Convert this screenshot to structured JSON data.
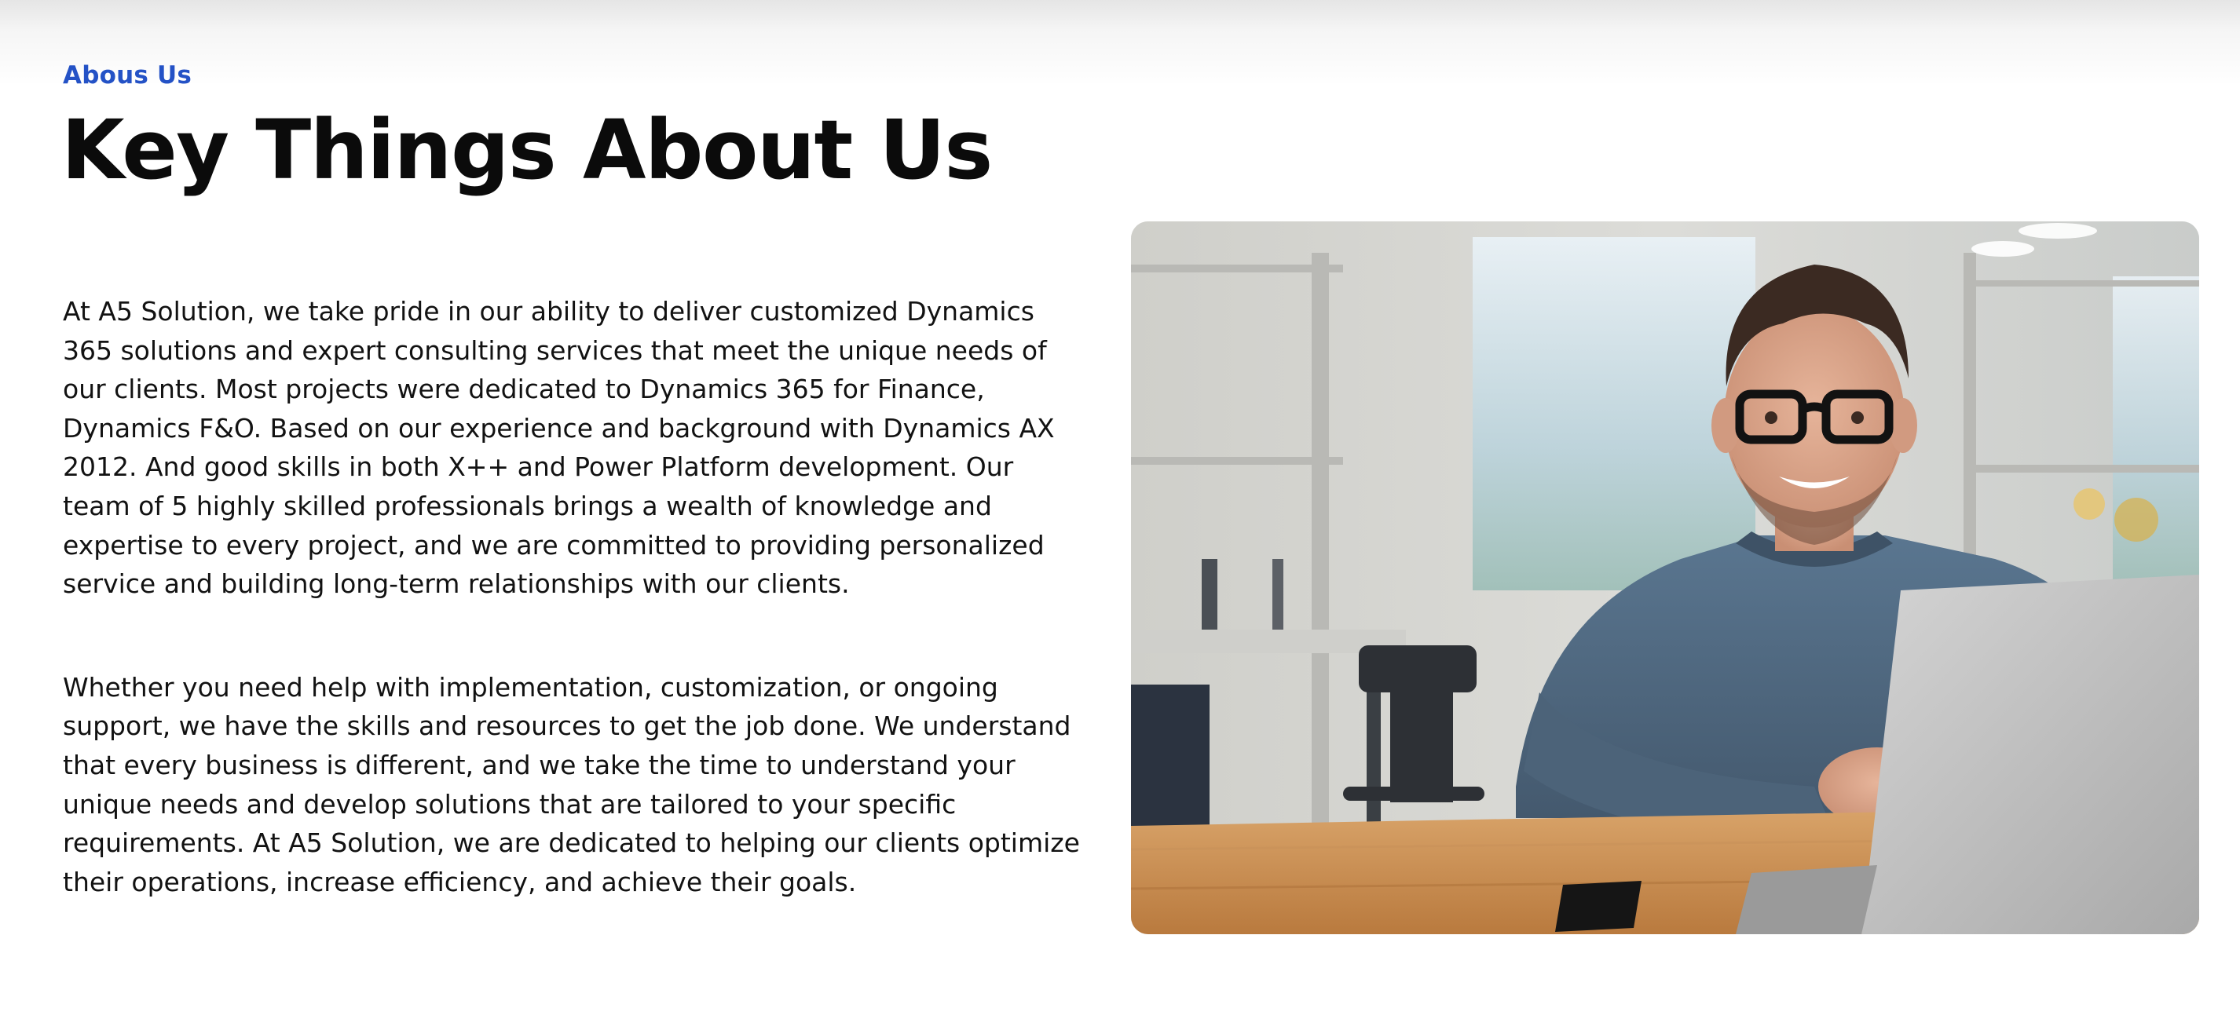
{
  "about": {
    "eyebrow": "Abous Us",
    "heading": "Key Things About Us",
    "paragraphs": [
      "At A5 Solution, we take pride in our ability to deliver customized Dynamics 365 solutions and expert consulting services that meet the unique needs of our clients. Most projects were dedicated to Dynamics 365 for Finance, Dynamics F&O. Based on our experience and background with Dynamics AX 2012. And good skills in both X++ and Power Platform development. Our team of 5 highly skilled professionals brings a wealth of knowledge and expertise to every project, and we are committed to providing personalized service and building long-term relationships with our clients.",
      "Whether you need help with implementation, customization, or ongoing support, we have the skills and resources to get the job done. We understand that every business is different, and we take the time to understand your unique needs and develop solutions that are tailored to your specific requirements. At A5 Solution, we are dedicated to helping our clients optimize their operations, increase efficiency, and achieve their goals."
    ]
  },
  "colors": {
    "accent": "#2452c6",
    "text": "#111111",
    "background": "#ffffff"
  }
}
